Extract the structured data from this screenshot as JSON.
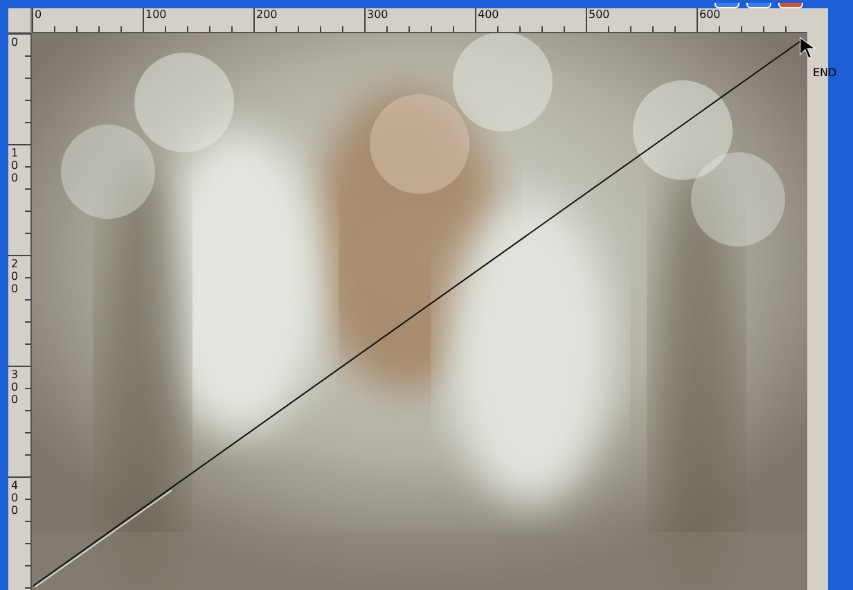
{
  "horizontal_ruler": {
    "labels": [
      "0",
      "100",
      "200",
      "300",
      "400",
      "500",
      "600"
    ]
  },
  "vertical_ruler": {
    "labels": [
      "0",
      "100",
      "200",
      "300",
      "400"
    ]
  },
  "line_end_label": "END"
}
